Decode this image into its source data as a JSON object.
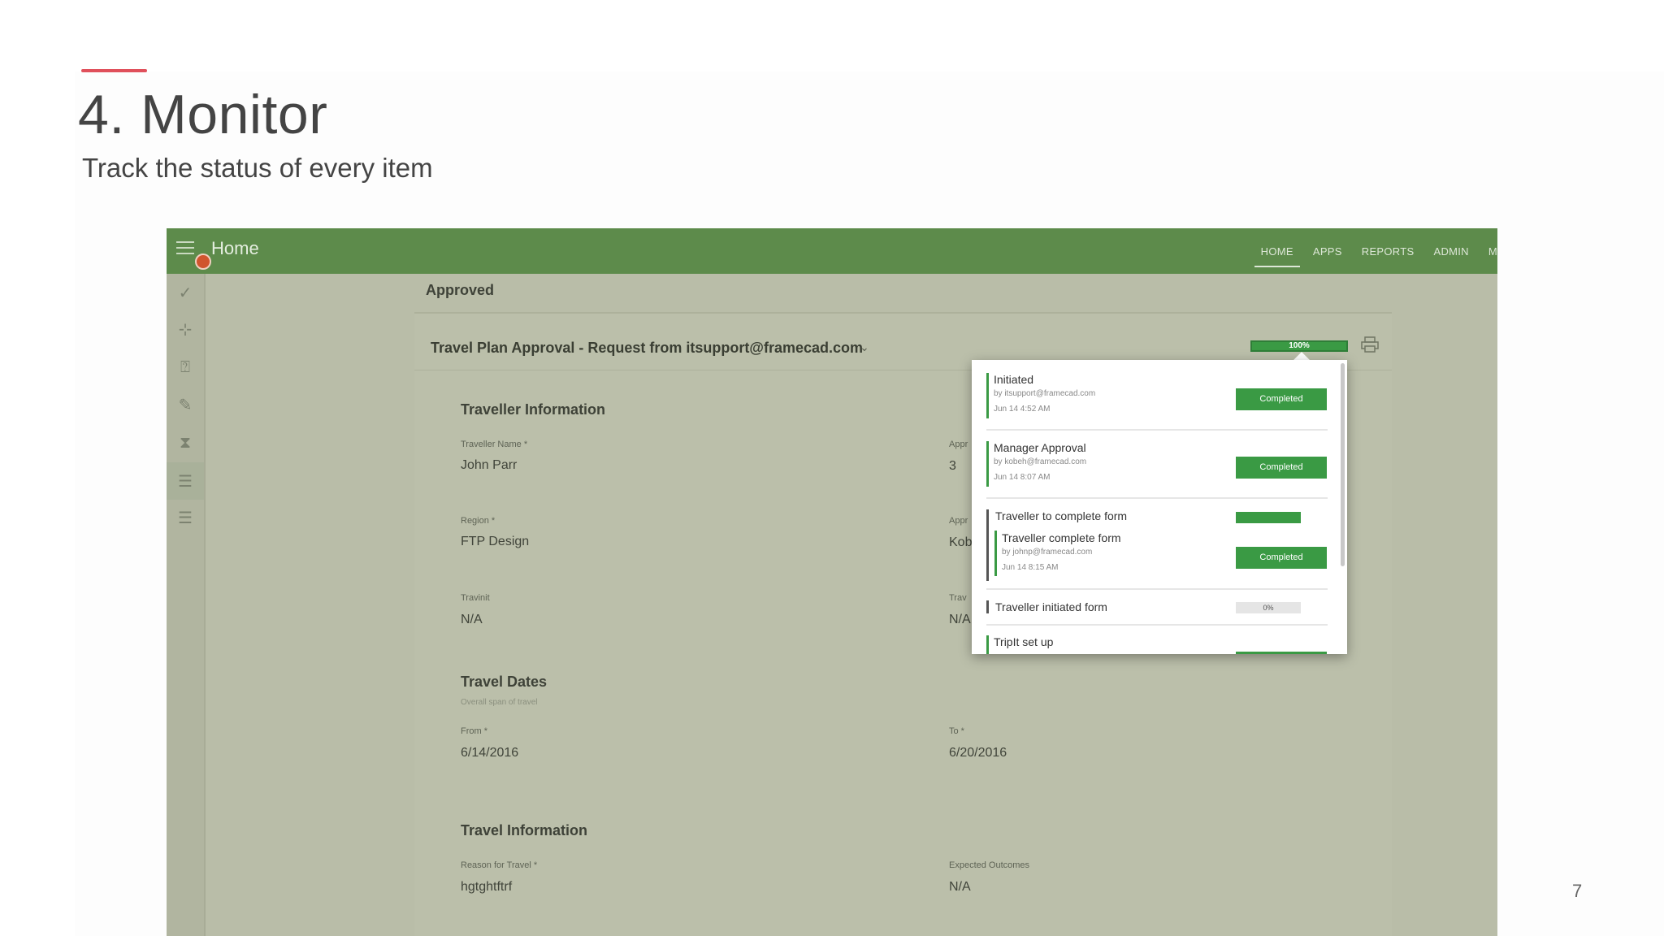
{
  "slide": {
    "title": "4. Monitor",
    "subtitle": "Track the status of every item",
    "page_number": "7",
    "accent_color": "#e0505b"
  },
  "app": {
    "title": "Home",
    "brand_color": "#5d8b4b",
    "nav": [
      "HOME",
      "APPS",
      "REPORTS",
      "ADMIN",
      "M"
    ],
    "sidebar_icons": [
      "check-icon",
      "workflow-icon",
      "help-icon",
      "edit-icon",
      "hourglass-icon",
      "checklist-icon",
      "list-icon"
    ],
    "status_header": "Approved",
    "request": {
      "title": "Travel Plan Approval - Request from itsupport@framecad.com",
      "progress": "100%"
    },
    "sections": {
      "traveller_info": {
        "title": "Traveller Information",
        "traveller_name_label": "Traveller Name *",
        "traveller_name": "John Parr",
        "region_label": "Region *",
        "region": "FTP Design",
        "travinit_label": "Travinit",
        "travinit": "N/A",
        "appr_label_1": "Appr",
        "appr_value_1": "3",
        "appr_label_2": "Appr",
        "appr_value_2": "Kob",
        "trav_label": "Trav",
        "trav_value": "N/A"
      },
      "travel_dates": {
        "title": "Travel Dates",
        "hint": "Overall span of travel",
        "from_label": "From *",
        "from": "6/14/2016",
        "to_label": "To *",
        "to": "6/20/2016"
      },
      "travel_info": {
        "title": "Travel Information",
        "reason_label": "Reason for Travel *",
        "reason": "hgtghtftrf",
        "outcomes_label": "Expected Outcomes",
        "outcomes": "N/A"
      }
    },
    "steps": [
      {
        "name": "Initiated",
        "by": "by itsupport@framecad.com",
        "time": "Jun 14 4:52 AM",
        "status": "Completed"
      },
      {
        "name": "Manager Approval",
        "by": "by kobeh@framecad.com",
        "time": "Jun 14 8:07 AM",
        "status": "Completed"
      },
      {
        "name": "Traveller to complete form",
        "status": ""
      },
      {
        "name": "Traveller complete form",
        "by": "by johnp@framecad.com",
        "time": "Jun 14 8:15 AM",
        "status": "Completed"
      },
      {
        "name": "Traveller initiated form",
        "status": "0%"
      },
      {
        "name": "TripIt set up",
        "status": ""
      }
    ]
  }
}
